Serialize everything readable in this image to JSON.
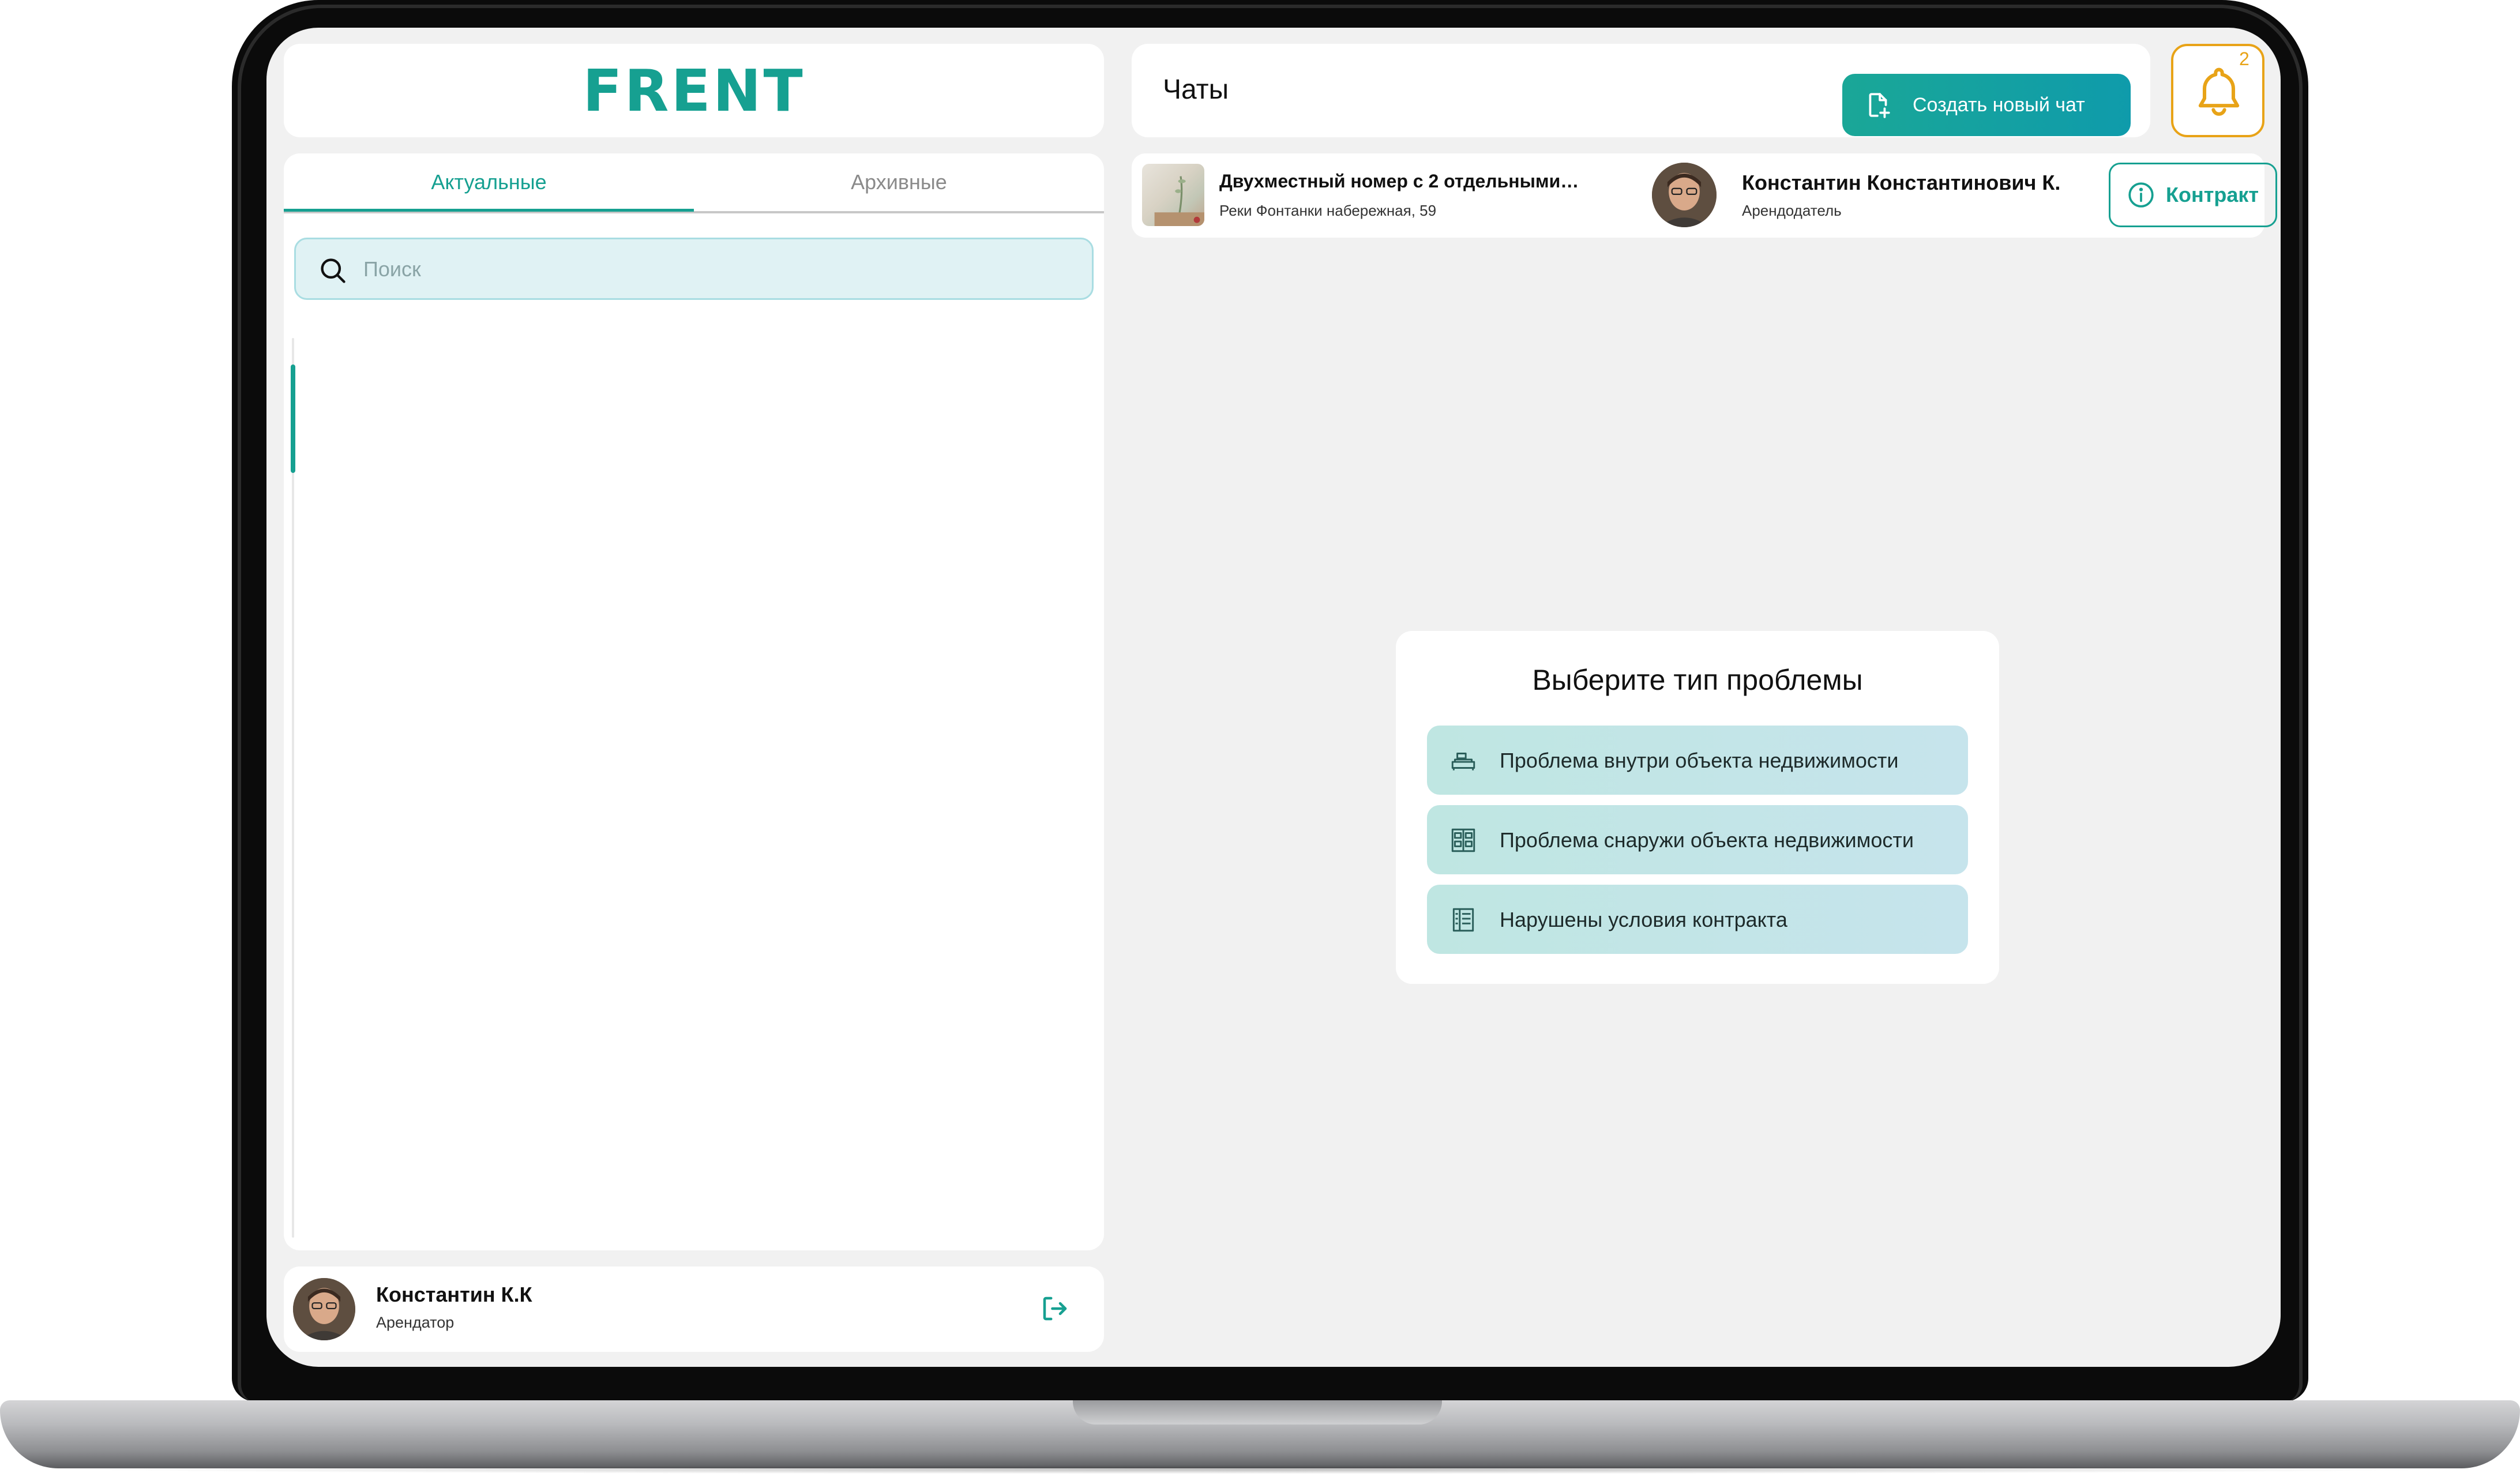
{
  "brand": {
    "logo_text": "FRENT",
    "accent_color": "#16a091",
    "notification_color": "#e8a317"
  },
  "sidebar": {
    "tabs": [
      {
        "label": "Актуальные",
        "active": true
      },
      {
        "label": "Архивные",
        "active": false
      }
    ],
    "search": {
      "placeholder": "Поиск",
      "value": "",
      "icon": "search-icon"
    },
    "current_user": {
      "name": "Константин К.К",
      "role": "Арендатор",
      "logout_icon": "logout-icon"
    }
  },
  "header": {
    "title": "Чаты",
    "new_chat_label": "Создать новый чат",
    "notifications_count": "2"
  },
  "chat_info": {
    "property_title": "Двухместный номер с 2 отдельными…",
    "property_address": "Реки Фонтанки набережная, 59",
    "landlord_name": "Константин Константинович К.",
    "landlord_role": "Арендодатель",
    "contract_label": "Контракт"
  },
  "problem_selector": {
    "title": "Выберите тип проблемы",
    "options": [
      {
        "label": "Проблема внутри объекта недвижимости",
        "icon": "sofa-icon"
      },
      {
        "label": "Проблема снаружи объекта недвижимости",
        "icon": "building-icon"
      },
      {
        "label": "Нарушены условия контракта",
        "icon": "document-icon"
      }
    ]
  }
}
